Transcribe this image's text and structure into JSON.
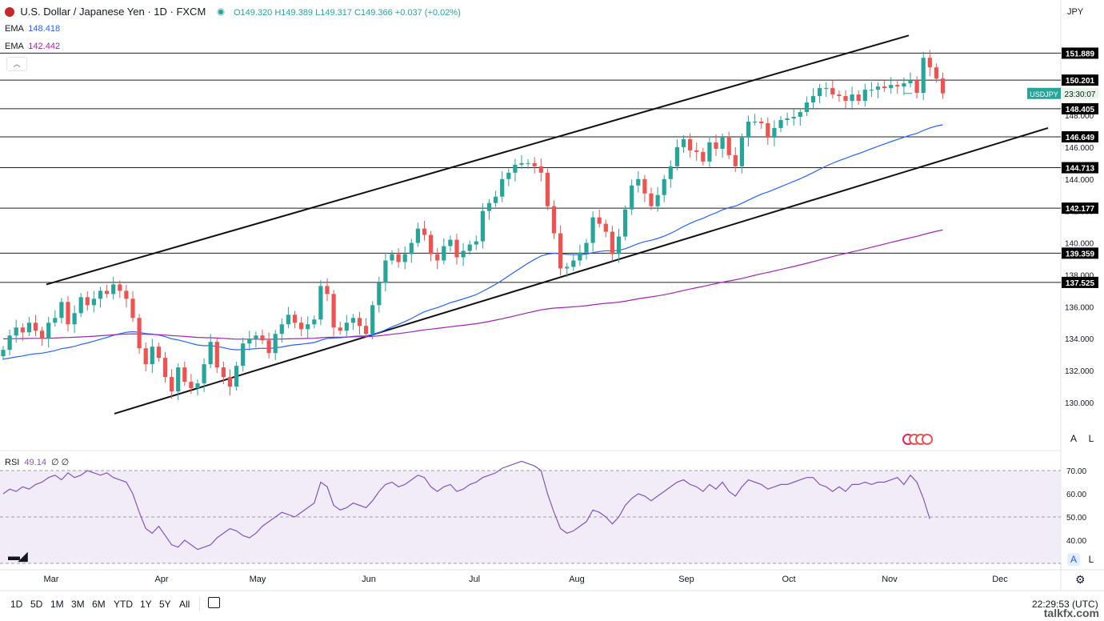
{
  "header": {
    "symbol_title": "U.S. Dollar / Japanese Yen · 1D · FXCM",
    "ohlc": "O149.320 H149.389 L149.317 C149.366 +0.037 (+0.02%)",
    "ema1_label": "EMA",
    "ema1_value": "148.418",
    "ema2_label": "EMA",
    "ema2_value": "142.442",
    "currency": "JPY"
  },
  "rsi_legend": {
    "label": "RSI",
    "value": "49.14",
    "extra": "∅ ∅"
  },
  "price_tag": {
    "symbol": "USDJPY",
    "countdown": "23:30:07"
  },
  "axis_buttons": {
    "auto": "A",
    "log": "L"
  },
  "timeframes": [
    "1D",
    "5D",
    "1M",
    "3M",
    "6M",
    "YTD",
    "1Y",
    "5Y",
    "All"
  ],
  "clock": "22:29:53 (UTC)",
  "watermark": "talkfx.com",
  "colors": {
    "up": "#26a69a",
    "down": "#ef5350",
    "ema_fast": "#2962ff",
    "ema_slow": "#9c27b0",
    "rsi": "#7e57c2",
    "rsi_band": "#ede7f6",
    "level_tag": "#000000"
  },
  "chart_data": [
    {
      "type": "candlestick",
      "title": "U.S. Dollar / Japanese Yen · 1D · FXCM",
      "y_ticks": [
        130,
        132,
        134,
        136,
        138,
        140,
        142,
        144,
        146,
        148
      ],
      "y_tick_labels": [
        "130.000",
        "132.000",
        "134.000",
        "136.000",
        "138.000",
        "140.000",
        "142.000",
        "144.000",
        "146.000",
        "148.000"
      ],
      "ylim": [
        128.0,
        155.5
      ],
      "x_tick_labels": [
        "Mar",
        "Apr",
        "May",
        "Jun",
        "Jul",
        "Aug",
        "Sep",
        "Oct",
        "Nov",
        "Dec"
      ],
      "horizontal_levels": [
        151.889,
        150.201,
        148.405,
        146.649,
        144.713,
        142.177,
        139.359,
        137.525
      ],
      "horizontal_level_labels": [
        "151.889",
        "150.201",
        "148.405",
        "146.649",
        "144.713",
        "142.177",
        "139.359",
        "137.525"
      ],
      "last_price": 149.366,
      "candle_closes": [
        133.3,
        134.2,
        134.7,
        134.4,
        135.0,
        134.5,
        134.0,
        135.0,
        135.3,
        136.3,
        134.9,
        135.6,
        136.6,
        136.1,
        136.5,
        137.0,
        136.8,
        137.4,
        137.0,
        136.5,
        135.3,
        133.4,
        132.4,
        133.5,
        132.8,
        131.6,
        130.7,
        132.2,
        131.3,
        130.9,
        131.2,
        132.4,
        133.8,
        132.2,
        131.6,
        131.0,
        132.3,
        133.7,
        134.0,
        134.2,
        133.9,
        133.1,
        134.3,
        134.9,
        135.5,
        135.0,
        134.6,
        134.9,
        135.2,
        137.3,
        136.8,
        134.7,
        134.5,
        135.0,
        135.3,
        134.8,
        134.3,
        136.1,
        137.5,
        138.9,
        139.3,
        138.8,
        139.3,
        140.0,
        140.9,
        140.5,
        139.3,
        138.9,
        139.8,
        140.2,
        139.1,
        139.5,
        139.9,
        140.1,
        142.0,
        142.5,
        142.9,
        144.0,
        144.4,
        144.9,
        145.0,
        145.0,
        144.8,
        144.4,
        142.3,
        140.6,
        138.4,
        138.5,
        138.9,
        139.4,
        140.0,
        141.6,
        141.2,
        140.7,
        139.3,
        140.4,
        142.1,
        143.6,
        144.0,
        143.1,
        142.3,
        143.0,
        144.0,
        144.8,
        146.0,
        146.5,
        145.8,
        145.7,
        145.1,
        146.3,
        145.9,
        146.6,
        145.5,
        144.8,
        146.6,
        147.6,
        147.6,
        147.5,
        146.6,
        147.2,
        147.7,
        147.8,
        147.9,
        148.2,
        148.8,
        149.2,
        149.7,
        149.7,
        149.3,
        149.2,
        148.9,
        149.3,
        148.9,
        149.6,
        149.6,
        149.8,
        149.7,
        149.9,
        149.8,
        150.0,
        150.2,
        149.4,
        151.6,
        151.0,
        150.3,
        149.37
      ],
      "ema_fast": {
        "start": 132.7,
        "end": 148.418
      },
      "ema_slow": {
        "start": 134.0,
        "end": 142.442
      },
      "channel_upper": {
        "from": "Mar",
        "start_value": 137.4,
        "end_value": 153.0
      },
      "channel_lower": {
        "from": "Mar",
        "start_value": 129.3,
        "end_value": 147.2
      }
    },
    {
      "type": "line",
      "title": "RSI",
      "y_ticks": [
        40,
        50,
        60,
        70
      ],
      "y_tick_labels": [
        "40.00",
        "50.00",
        "60.00",
        "70.00"
      ],
      "ylim": [
        30,
        75
      ],
      "band": [
        30,
        70
      ],
      "last_value": 49.14,
      "values": [
        60,
        62,
        61,
        63,
        62,
        64,
        65,
        67,
        68,
        66,
        69,
        67,
        68,
        70,
        69,
        68,
        69,
        67,
        66,
        65,
        60,
        52,
        45,
        43,
        46,
        42,
        38,
        37,
        40,
        38,
        36,
        37,
        38,
        41,
        43,
        45,
        44,
        42,
        41,
        43,
        46,
        48,
        50,
        52,
        51,
        50,
        52,
        54,
        56,
        65,
        63,
        55,
        53,
        54,
        56,
        55,
        54,
        57,
        61,
        64,
        65,
        63,
        64,
        66,
        68,
        67,
        63,
        61,
        63,
        64,
        61,
        62,
        64,
        65,
        67,
        68,
        69,
        71,
        72,
        73,
        74,
        73,
        72,
        70,
        60,
        52,
        45,
        43,
        44,
        46,
        48,
        53,
        52,
        50,
        47,
        50,
        55,
        58,
        60,
        59,
        57,
        59,
        61,
        63,
        65,
        66,
        64,
        63,
        61,
        64,
        62,
        65,
        61,
        59,
        63,
        66,
        65,
        64,
        62,
        63,
        64,
        64,
        65,
        66,
        67,
        67,
        64,
        63,
        61,
        63,
        61,
        64,
        64,
        65,
        64,
        65,
        65,
        66,
        67,
        64,
        68,
        65,
        58,
        49.14
      ]
    }
  ]
}
